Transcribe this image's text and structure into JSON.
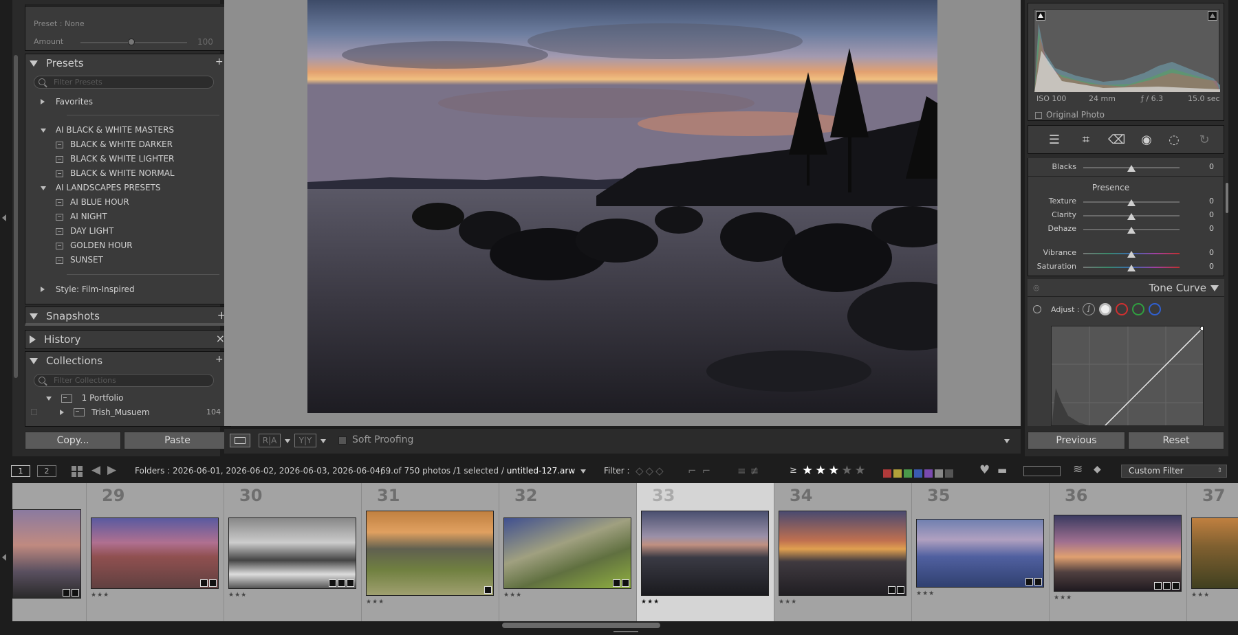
{
  "left_panel": {
    "preset_label": "Preset : None",
    "amount_label": "Amount",
    "amount_value": "100",
    "presets": {
      "title": "Presets",
      "add": "+.",
      "search_placeholder": "Filter Presets",
      "favorites": "Favorites",
      "groups": [
        {
          "name": "AI BLACK & WHITE MASTERS",
          "items": [
            "BLACK & WHITE DARKER",
            "BLACK & WHITE LIGHTER",
            "BLACK & WHITE NORMAL"
          ]
        },
        {
          "name": "AI LANDSCAPES PRESETS",
          "items": [
            "AI BLUE HOUR",
            "AI NIGHT",
            "DAY LIGHT",
            "GOLDEN HOUR",
            "SUNSET"
          ]
        }
      ],
      "style_group": "Style: Film-Inspired"
    },
    "snapshots": {
      "title": "Snapshots",
      "add": "+"
    },
    "history": {
      "title": "History",
      "clear": "×"
    },
    "collections": {
      "title": "Collections",
      "add": "+.",
      "search_placeholder": "Filter Collections",
      "items": [
        {
          "name": "1 Portfolio",
          "count": ""
        },
        {
          "name": "Trish_Musuem",
          "count": "104"
        }
      ]
    },
    "copy_button": "Copy...",
    "paste_button": "Paste"
  },
  "toolbar": {
    "soft_proofing": "Soft Proofing"
  },
  "right_panel": {
    "exif": {
      "iso": "ISO 100",
      "focal": "24 mm",
      "aperture": "ƒ / 6.3",
      "shutter": "15.0 sec"
    },
    "original_photo": "Original Photo",
    "blacks": {
      "label": "Blacks",
      "value": "0"
    },
    "presence": {
      "title": "Presence",
      "sliders": [
        {
          "label": "Texture",
          "value": "0"
        },
        {
          "label": "Clarity",
          "value": "0"
        },
        {
          "label": "Dehaze",
          "value": "0"
        },
        {
          "label": "Vibrance",
          "value": "0"
        },
        {
          "label": "Saturation",
          "value": "0"
        }
      ]
    },
    "tone_curve": {
      "title": "Tone Curve",
      "adjust_label": "Adjust :"
    },
    "previous_button": "Previous",
    "reset_button": "Reset"
  },
  "filmstrip_bar": {
    "view1": "1",
    "view2": "2",
    "folders": "Folders : 2026-06-01, 2026-06-02, 2026-06-03, 2026-06-04, ...",
    "count": "69 of 750 photos /1 selected /",
    "filename": "untitled-127.arw",
    "filter_label": "Filter :",
    "rating_op": "≥",
    "custom_filter": "Custom Filter"
  },
  "filmstrip": {
    "cells": [
      {
        "num": "",
        "stars": ""
      },
      {
        "num": "29",
        "stars": "★★★"
      },
      {
        "num": "30",
        "stars": "★★★"
      },
      {
        "num": "31",
        "stars": "★★★"
      },
      {
        "num": "32",
        "stars": "★★★"
      },
      {
        "num": "33",
        "stars": "★★★"
      },
      {
        "num": "34",
        "stars": "★★★"
      },
      {
        "num": "35",
        "stars": "★★★"
      },
      {
        "num": "36",
        "stars": "★★★"
      },
      {
        "num": "37",
        "stars": "★★★"
      }
    ],
    "selected_index": 5
  },
  "colors": {
    "panel_bg": "#3a3a3a",
    "filmstrip_bg": "#a3a3a3",
    "selected_cell": "#d5d5d5",
    "label_red": "#b03a3a",
    "label_yellow": "#b3a23a",
    "label_green": "#4a9a4a",
    "label_blue": "#3a5ab0",
    "label_purple": "#7a4ab0"
  }
}
